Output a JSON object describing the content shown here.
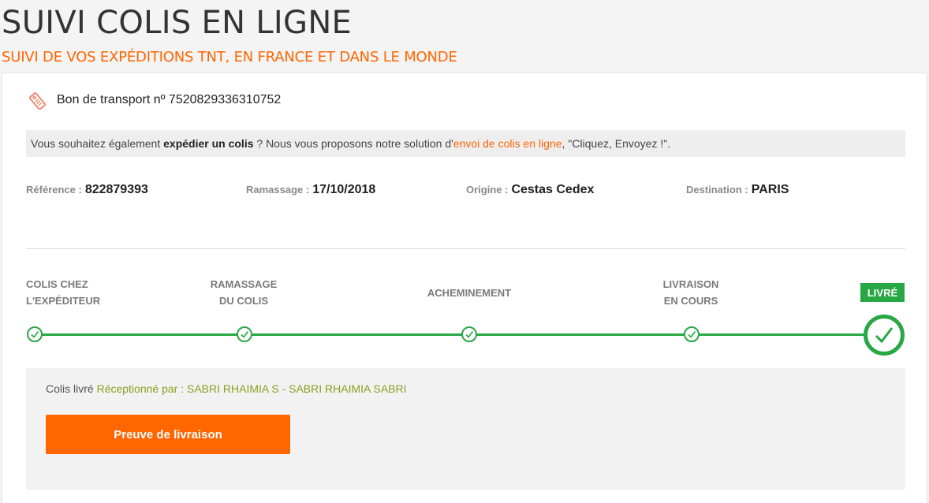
{
  "header": {
    "title": "SUIVI COLIS EN LIGNE",
    "subtitle": "SUIVI DE VOS EXPÉDITIONS TNT, EN FRANCE ET DANS LE MONDE"
  },
  "waybill": {
    "icon": "shipping-tag-icon",
    "label": "Bon de transport nº 7520829336310752"
  },
  "promo": {
    "before": "Vous souhaitez également ",
    "bold": "expédier un colis",
    "middle": " ? Nous vous proposons notre solution d'",
    "link": "envoi de colis en ligne",
    "after": ", \"Cliquez, Envoyez !\"."
  },
  "meta": {
    "reference_label": "Référence :",
    "reference_value": "822879393",
    "pickup_label": "Ramassage :",
    "pickup_value": "17/10/2018",
    "origin_label": "Origine :",
    "origin_value": "Cestas Cedex",
    "destination_label": "Destination :",
    "destination_value": "PARIS"
  },
  "steps": {
    "s1_line1": "COLIS CHEZ",
    "s1_line2": "L'EXPÉDITEUR",
    "s2_line1": "RAMASSAGE",
    "s2_line2": "DU COLIS",
    "s3": "ACHEMINEMENT",
    "s4_line1": "LIVRAISON",
    "s4_line2": "EN COURS",
    "s5": "LIVRÉ"
  },
  "status": {
    "state": "Colis livré",
    "received_by": "Réceptionné par : SABRI RHAIMIA S - SABRI RHAIMIA SABRI",
    "proof_button": "Preuve de livraison"
  },
  "colors": {
    "accent": "#ff6600",
    "success": "#28a745",
    "received_text": "#8aa020"
  }
}
